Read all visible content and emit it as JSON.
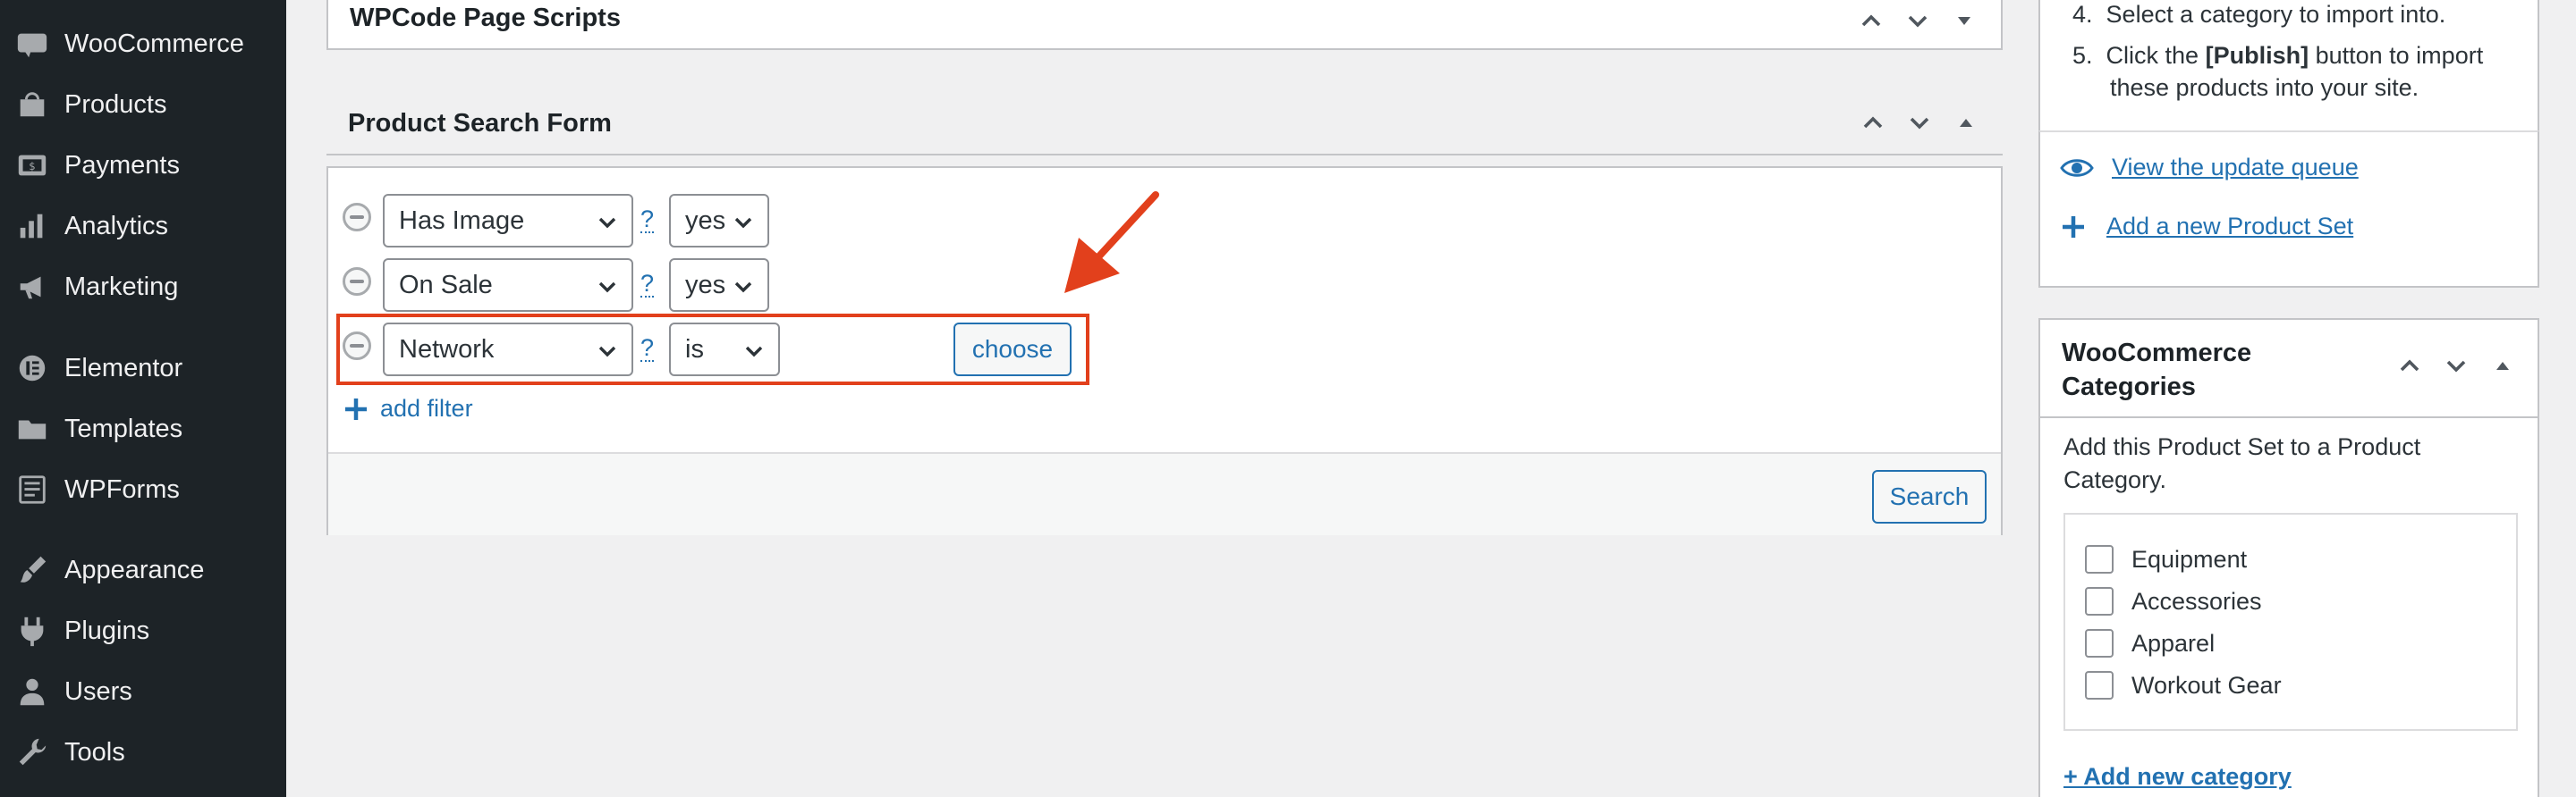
{
  "sidebar": {
    "items": [
      {
        "label": "WooCommerce",
        "icon": "woocommerce-icon"
      },
      {
        "label": "Products",
        "icon": "products-icon"
      },
      {
        "label": "Payments",
        "icon": "payments-icon"
      },
      {
        "label": "Analytics",
        "icon": "analytics-icon"
      },
      {
        "label": "Marketing",
        "icon": "marketing-icon"
      },
      {
        "label": "Elementor",
        "icon": "elementor-icon"
      },
      {
        "label": "Templates",
        "icon": "templates-icon"
      },
      {
        "label": "WPForms",
        "icon": "wpforms-icon"
      },
      {
        "label": "Appearance",
        "icon": "appearance-icon"
      },
      {
        "label": "Plugins",
        "icon": "plugins-icon"
      },
      {
        "label": "Users",
        "icon": "users-icon"
      },
      {
        "label": "Tools",
        "icon": "tools-icon"
      }
    ],
    "woo_badge": "Woo"
  },
  "wpcode_box": {
    "title": "WPCode Page Scripts"
  },
  "search_form": {
    "title": "Product Search Form",
    "filters": [
      {
        "field": "Has Image",
        "help": "?",
        "operator": "yes"
      },
      {
        "field": "On Sale",
        "help": "?",
        "operator": "yes"
      },
      {
        "field": "Network",
        "help": "?",
        "operator": "is",
        "choose_label": "choose"
      }
    ],
    "add_filter_label": "add filter",
    "search_button": "Search"
  },
  "instructions": {
    "step4_num": "4.",
    "step4_text": "Select a category to import into.",
    "step5_num": "5.",
    "step5_pre": "Click the ",
    "step5_bold": "[Publish]",
    "step5_post": " button to import",
    "step5_line2": "these products into your site."
  },
  "actions": {
    "view_queue": "View the update queue",
    "add_product_set": "Add a new Product Set"
  },
  "categories_box": {
    "title_line1": "WooCommerce",
    "title_line2": "Categories",
    "description_line1": "Add this Product Set to a Product",
    "description_line2": "Category.",
    "categories": [
      "Equipment",
      "Accessories",
      "Apparel",
      "Workout Gear"
    ],
    "add_new": "+ Add new category"
  },
  "colors": {
    "accent": "#2271b1",
    "highlight": "#e2401c",
    "sidebar_bg": "#1d2327"
  }
}
